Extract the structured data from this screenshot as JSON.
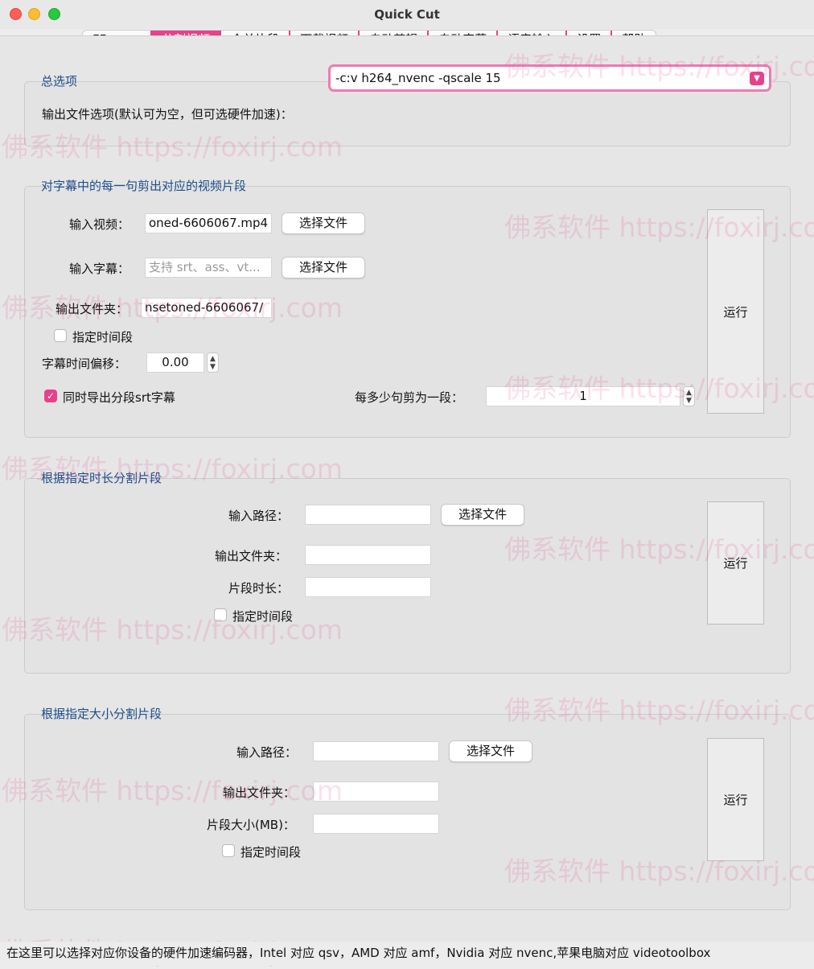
{
  "window": {
    "title": "Quick Cut"
  },
  "tabs": [
    "FFmpeg",
    "分割视频",
    "合并片段",
    "下载视频",
    "自动剪辑",
    "自动字幕",
    "语音输入",
    "设置",
    "帮助"
  ],
  "general": {
    "title": "总选项",
    "output_label": "输出文件选项(默认可为空，但可选硬件加速)：",
    "output_value": "-c:v h264_nvenc -qscale 15"
  },
  "subtitle_cut": {
    "title": "对字幕中的每一句剪出对应的视频片段",
    "video_label": "输入视频：",
    "video_value": "oned-6606067.mp4",
    "subtitle_label": "输入字幕：",
    "subtitle_placeholder": "支持 srt、ass、vt...",
    "output_dir_label": "输出文件夹：",
    "output_dir_value": "nsetoned-6606067/",
    "choose_file": "选择文件",
    "time_range_label": "指定时间段",
    "offset_label": "字幕时间偏移：",
    "offset_value": "0.00",
    "export_srt_label": "同时导出分段srt字幕",
    "per_segment_label": "每多少句剪为一段：",
    "per_segment_value": "1",
    "run": "运行"
  },
  "duration_split": {
    "title": "根据指定时长分割片段",
    "input_label": "输入路径：",
    "choose_file": "选择文件",
    "output_dir_label": "输出文件夹：",
    "segment_len_label": "片段时长：",
    "time_range_label": "指定时间段",
    "run": "运行"
  },
  "size_split": {
    "title": "根据指定大小分割片段",
    "input_label": "输入路径：",
    "choose_file": "选择文件",
    "output_dir_label": "输出文件夹：",
    "segment_size_label": "片段大小(MB)：",
    "time_range_label": "指定时间段",
    "run": "运行"
  },
  "status": "在这里可以选择对应你设备的硬件加速编码器，Intel 对应 qsv，AMD 对应 amf，Nvidia 对应 nvenc,苹果电脑对应 videotoolbox",
  "watermark": "佛系软件 https://foxirj.com",
  "colors": {
    "accent": "#e8408a",
    "group_title": "#1d4e89"
  }
}
